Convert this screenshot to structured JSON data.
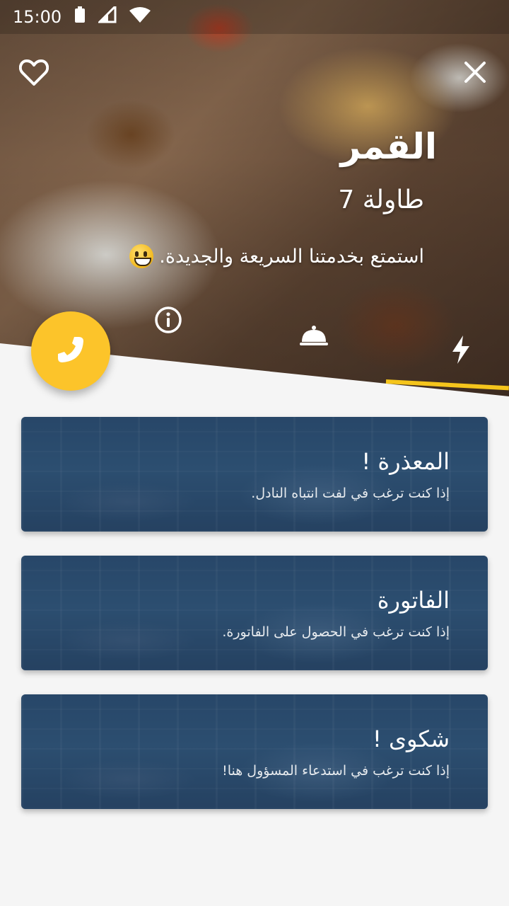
{
  "status_bar": {
    "time": "15:00",
    "icons": [
      "battery-icon",
      "signal-icon",
      "wifi-icon"
    ]
  },
  "header": {
    "favorite_icon": "heart-icon",
    "close_icon": "close-icon",
    "restaurant_name": "القمر",
    "table_label": "طاولة 7",
    "welcome_text": "استمتع بخدمتنا السريعة والجديدة."
  },
  "tabs": [
    {
      "icon": "info-icon"
    },
    {
      "icon": "room-service-bell-icon"
    },
    {
      "icon": "lightning-icon",
      "active": true
    }
  ],
  "fab": {
    "icon": "phone-icon"
  },
  "colors": {
    "accent": "#fcc42a",
    "card_blue": "#2e4d6e",
    "background": "#f5f5f5"
  },
  "cards": [
    {
      "title": "المعذرة !",
      "subtitle": "إذا كنت ترغب في لفت انتباه النادل."
    },
    {
      "title": "الفاتورة",
      "subtitle": "إذا كنت ترغب في الحصول على الفاتورة."
    },
    {
      "title": "شكوى !",
      "subtitle": "إذا كنت ترغب في استدعاء المسؤول هنا!"
    }
  ]
}
